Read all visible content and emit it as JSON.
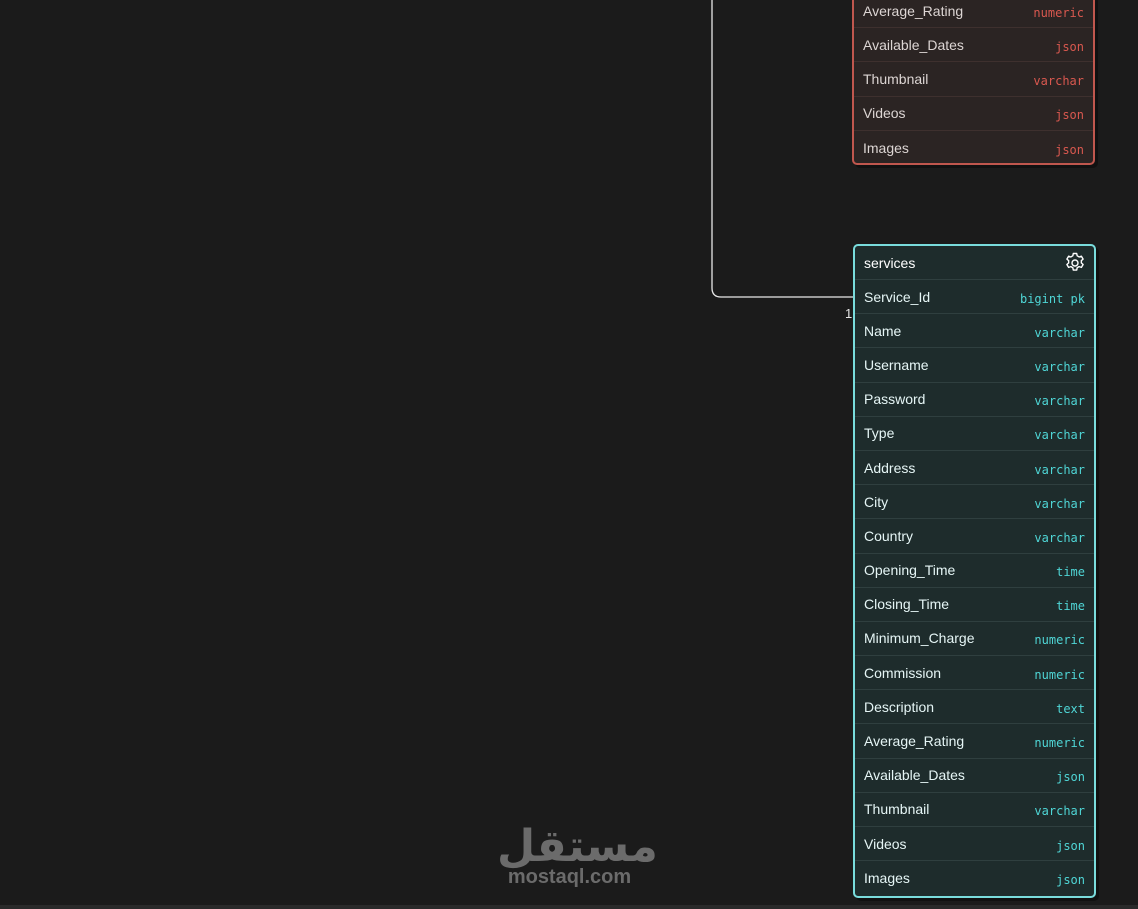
{
  "tables": {
    "upper": {
      "color": "#c0574e",
      "rows": [
        {
          "name": "Average_Rating",
          "type": "numeric"
        },
        {
          "name": "Available_Dates",
          "type": "json"
        },
        {
          "name": "Thumbnail",
          "type": "varchar"
        },
        {
          "name": "Videos",
          "type": "json"
        },
        {
          "name": "Images",
          "type": "json"
        }
      ]
    },
    "services": {
      "color": "#79dcdc",
      "title": "services",
      "header_icon": "gear-icon",
      "rows": [
        {
          "name": "Service_Id",
          "type": "bigint pk"
        },
        {
          "name": "Name",
          "type": "varchar"
        },
        {
          "name": "Username",
          "type": "varchar"
        },
        {
          "name": "Password",
          "type": "varchar"
        },
        {
          "name": "Type",
          "type": "varchar"
        },
        {
          "name": "Address",
          "type": "varchar"
        },
        {
          "name": "City",
          "type": "varchar"
        },
        {
          "name": "Country",
          "type": "varchar"
        },
        {
          "name": "Opening_Time",
          "type": "time"
        },
        {
          "name": "Closing_Time",
          "type": "time"
        },
        {
          "name": "Minimum_Charge",
          "type": "numeric"
        },
        {
          "name": "Commission",
          "type": "numeric"
        },
        {
          "name": "Description",
          "type": "text"
        },
        {
          "name": "Average_Rating",
          "type": "numeric"
        },
        {
          "name": "Available_Dates",
          "type": "json"
        },
        {
          "name": "Thumbnail",
          "type": "varchar"
        },
        {
          "name": "Videos",
          "type": "json"
        },
        {
          "name": "Images",
          "type": "json"
        }
      ]
    }
  },
  "relationship": {
    "cardinality_label": "1"
  },
  "watermark": {
    "arabic": "مستقل",
    "latin": "mostaql.com"
  }
}
